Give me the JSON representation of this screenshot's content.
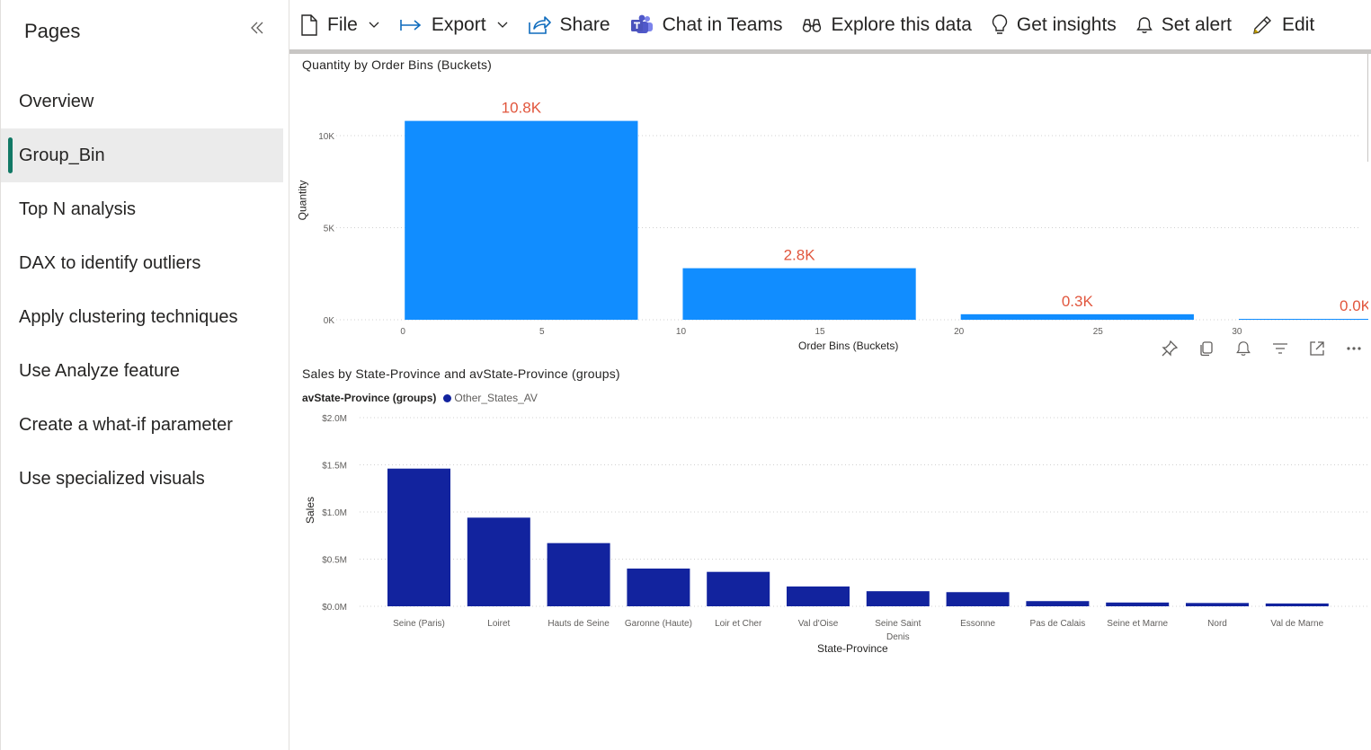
{
  "sidebar": {
    "title": "Pages",
    "items": [
      {
        "label": "Overview",
        "active": false
      },
      {
        "label": "Group_Bin",
        "active": true
      },
      {
        "label": "Top N analysis",
        "active": false
      },
      {
        "label": "DAX to identify outliers",
        "active": false
      },
      {
        "label": "Apply clustering techniques",
        "active": false
      },
      {
        "label": "Use Analyze feature",
        "active": false
      },
      {
        "label": "Create a what-if parameter",
        "active": false
      },
      {
        "label": "Use specialized visuals",
        "active": false
      }
    ]
  },
  "toolbar": {
    "file": "File",
    "export": "Export",
    "share": "Share",
    "chat": "Chat in Teams",
    "explore": "Explore this data",
    "insights": "Get insights",
    "alert": "Set alert",
    "edit": "Edit"
  },
  "colors": {
    "accent_bar": "#117865",
    "chart1_bar": "#118dff",
    "chart1_label": "#e1563d",
    "chart2_bar": "#12239e"
  },
  "chart_data": [
    {
      "type": "bar",
      "title": "Quantity by Order Bins (Buckets)",
      "xlabel": "Order Bins (Buckets)",
      "ylabel": "Quantity",
      "bins": [
        0,
        10,
        20,
        30
      ],
      "bin_width": 10,
      "values": [
        10800,
        2800,
        300,
        0
      ],
      "data_labels": [
        "10.8K",
        "2.8K",
        "0.3K",
        "0.0K"
      ],
      "x_ticks": [
        "0",
        "5",
        "10",
        "15",
        "20",
        "25",
        "30"
      ],
      "y_ticks": [
        {
          "v": 0,
          "label": "0K"
        },
        {
          "v": 5000,
          "label": "5K"
        },
        {
          "v": 10000,
          "label": "10K"
        }
      ],
      "ylim": [
        0,
        12000
      ],
      "grid": true
    },
    {
      "type": "bar",
      "title": "Sales by State-Province and avState-Province (groups)",
      "xlabel": "State-Province",
      "ylabel": "Sales",
      "legend_title": "avState-Province (groups)",
      "series": [
        {
          "name": "Other_States_AV",
          "values": [
            1460000,
            940000,
            670000,
            400000,
            365000,
            210000,
            160000,
            150000,
            55000,
            40000,
            35000,
            30000
          ]
        }
      ],
      "categories": [
        "Seine (Paris)",
        "Loiret",
        "Hauts de Seine",
        "Garonne (Haute)",
        "Loir et Cher",
        "Val d'Oise",
        "Seine Saint Denis",
        "Essonne",
        "Pas de Calais",
        "Seine et Marne",
        "Nord",
        "Val de Marne"
      ],
      "y_ticks": [
        {
          "v": 0,
          "label": "$0.0M"
        },
        {
          "v": 500000,
          "label": "$0.5M"
        },
        {
          "v": 1000000,
          "label": "$1.0M"
        },
        {
          "v": 1500000,
          "label": "$1.5M"
        },
        {
          "v": 2000000,
          "label": "$2.0M"
        }
      ],
      "ylim": [
        0,
        2000000
      ],
      "grid": true,
      "legend_position": "top-left"
    }
  ]
}
